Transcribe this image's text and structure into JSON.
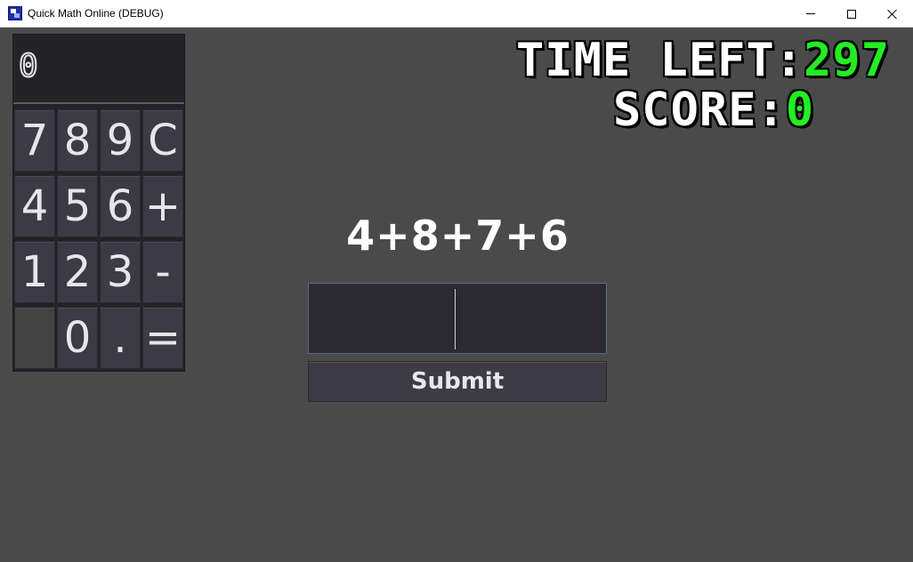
{
  "window": {
    "title": "Quick Math Online (DEBUG)",
    "app_icon": "quick-math-app-icon",
    "controls": [
      "minimize",
      "maximize",
      "close"
    ]
  },
  "calculator": {
    "display": "0",
    "keys": [
      "7",
      "8",
      "9",
      "C",
      "4",
      "5",
      "6",
      "+",
      "1",
      "2",
      "3",
      "-",
      "",
      "0",
      ".",
      "="
    ]
  },
  "hud": {
    "time_label": "TIME LEFT:",
    "time_value": "297",
    "score_label": "SCORE:",
    "score_value": "0",
    "value_color": "#22ee22"
  },
  "game": {
    "problem": "4+8+7+6",
    "answer_value": "",
    "submit_label": "Submit"
  }
}
